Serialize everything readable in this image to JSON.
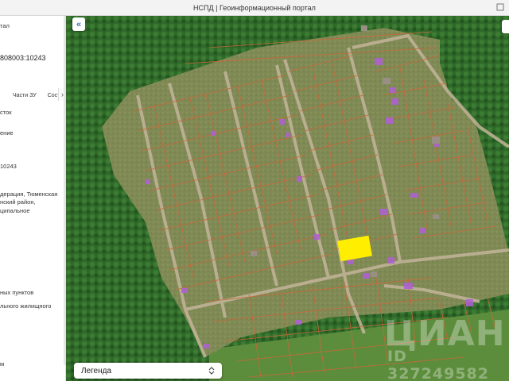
{
  "window": {
    "title": "НСПД | Геоинформационный портал"
  },
  "panel": {
    "lines": [
      "тал",
      "808003:10243",
      "сток",
      "ение",
      "10243",
      "дерация, Тюменская",
      "нский район,",
      "ципальное",
      "ных пунктов",
      "льного жилищного",
      "м"
    ],
    "tabs": [
      "Части ЗУ",
      "Сост"
    ]
  },
  "map": {
    "legend_label": "Легенда",
    "watermark_brand": "ЦИАН",
    "watermark_id": "ID 327249582",
    "colors": {
      "selected_parcel": "#ffee00",
      "parcel_border": "#c9683a",
      "building": "#b05fd6"
    }
  }
}
